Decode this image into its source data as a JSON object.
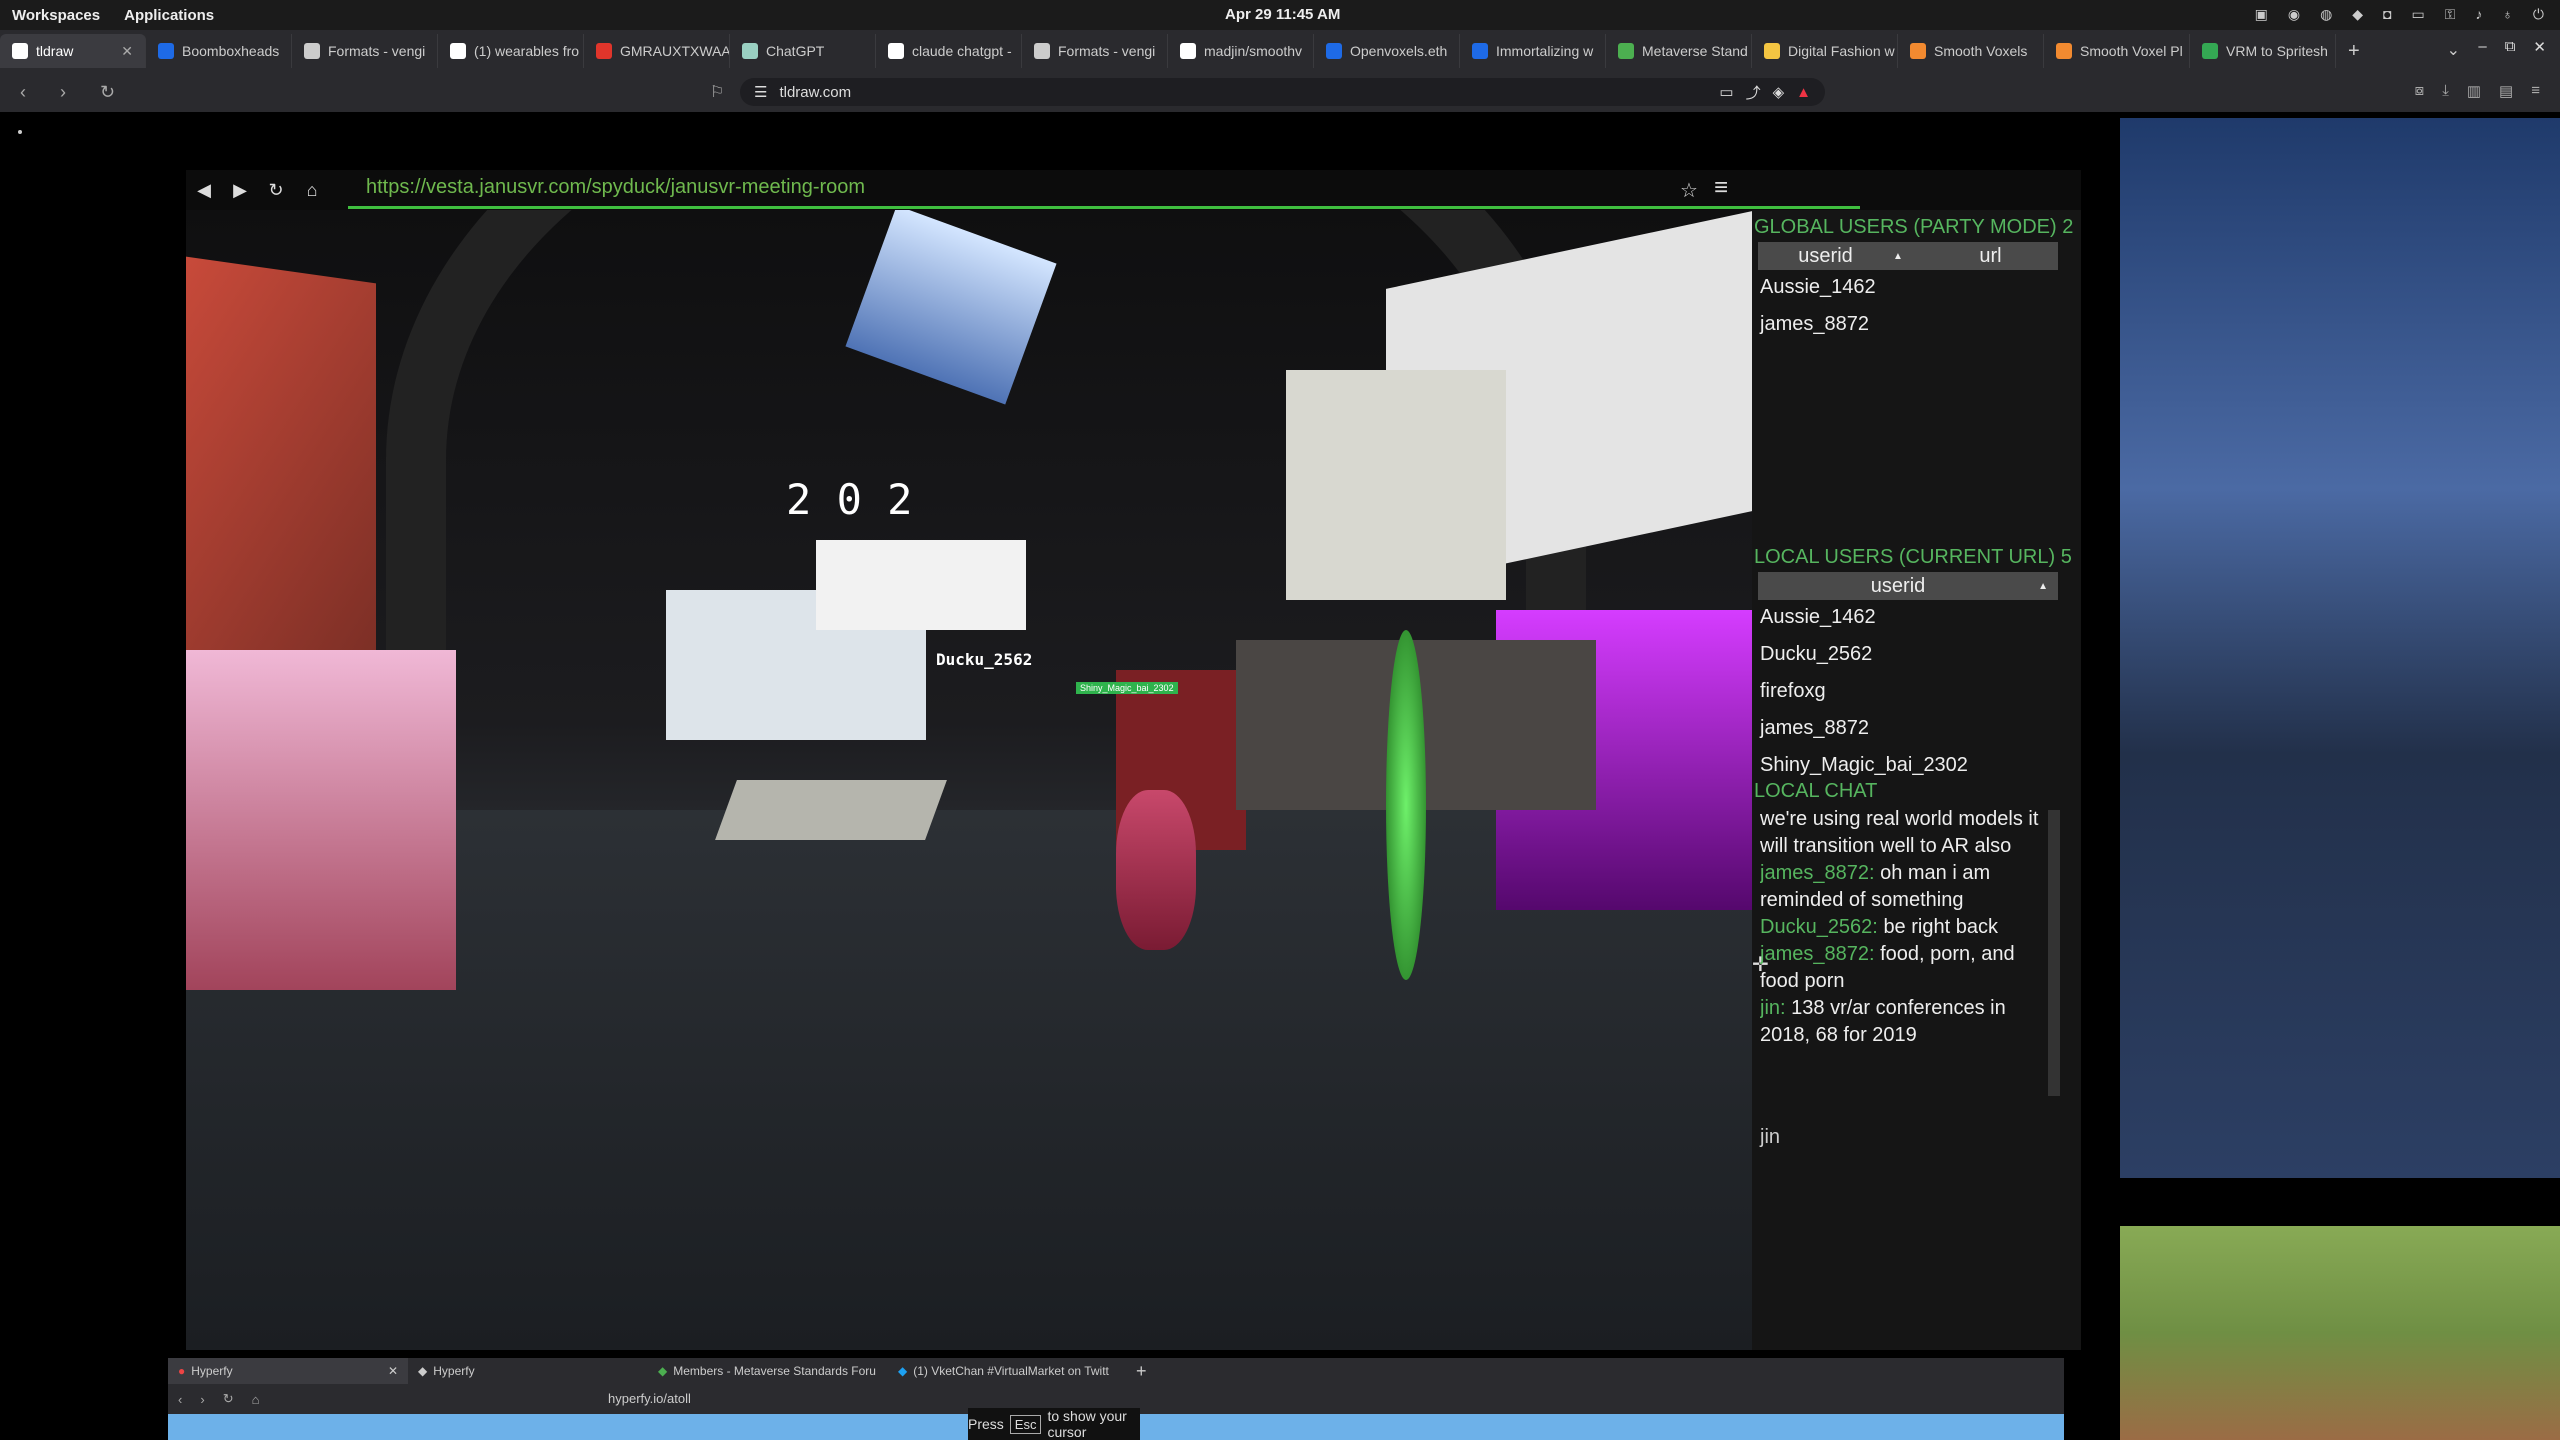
{
  "system_bar": {
    "workspaces": "Workspaces",
    "applications": "Applications",
    "clock": "Apr 29  11:45 AM"
  },
  "browser": {
    "tabs": [
      {
        "label": "tldraw",
        "icon_color": "#ffffff",
        "active": true
      },
      {
        "label": "Boomboxheads",
        "icon_color": "#1e6ae6"
      },
      {
        "label": "Formats - vengi",
        "icon_color": "#cccccc"
      },
      {
        "label": "(1) wearables fro",
        "icon_color": "#ffffff"
      },
      {
        "label": "GMRAUXTXWAAD",
        "icon_color": "#e0352b"
      },
      {
        "label": "ChatGPT",
        "icon_color": "#9ad0c2"
      },
      {
        "label": "claude chatgpt -",
        "icon_color": "#ffffff"
      },
      {
        "label": "Formats - vengi",
        "icon_color": "#cccccc"
      },
      {
        "label": "madjin/smoothv",
        "icon_color": "#ffffff"
      },
      {
        "label": "Openvoxels.eth",
        "icon_color": "#1e6ae6"
      },
      {
        "label": "Immortalizing w",
        "icon_color": "#1e6ae6"
      },
      {
        "label": "Metaverse Stand",
        "icon_color": "#4caf50"
      },
      {
        "label": "Digital Fashion w",
        "icon_color": "#f4c542"
      },
      {
        "label": "Smooth Voxels",
        "icon_color": "#f28a30"
      },
      {
        "label": "Smooth Voxel Pl",
        "icon_color": "#f28a30"
      },
      {
        "label": "VRM to Spritesh",
        "icon_color": "#34a853"
      }
    ],
    "url": "tldraw.com"
  },
  "janus": {
    "url": "https://vesta.janusvr.com/spyduck/janusvr-meeting-room",
    "scene_labels": {
      "year": "2 0 2",
      "avatar_name": "Ducku_2562",
      "tag": "Shiny_Magic_bai_2302"
    },
    "global_users_title": "GLOBAL USERS (PARTY MODE) 2",
    "global_columns": [
      "userid",
      "url"
    ],
    "global_users": [
      "Aussie_1462",
      "james_8872"
    ],
    "local_users_title": "LOCAL USERS (CURRENT URL) 5",
    "local_column": "userid",
    "local_users": [
      "Aussie_1462",
      "Ducku_2562",
      "firefoxg",
      "james_8872",
      "Shiny_Magic_bai_2302"
    ],
    "local_chat_title": "LOCAL CHAT",
    "chat_intro": "we're using real world models it will transition well to AR also",
    "chat": [
      {
        "user": "james_8872:",
        "text": "oh man i am reminded of something"
      },
      {
        "user": "Ducku_2562:",
        "text": "be right back"
      },
      {
        "user": "james_8872:",
        "text": "food, porn, and food porn"
      },
      {
        "user": "jin:",
        "text": "138 vr/ar conferences in 2018, 68 for 2019"
      }
    ],
    "chat_input_value": "jin"
  },
  "hyperfy": {
    "tabs": [
      "Hyperfy",
      "Hyperfy",
      "Members - Metaverse Standards Foru",
      "(1) VketChan #VirtualMarket on Twitt"
    ],
    "url": "hyperfy.io/atoll",
    "esc_hint": {
      "press": "Press",
      "key": "Esc",
      "rest": "to show your cursor"
    }
  }
}
